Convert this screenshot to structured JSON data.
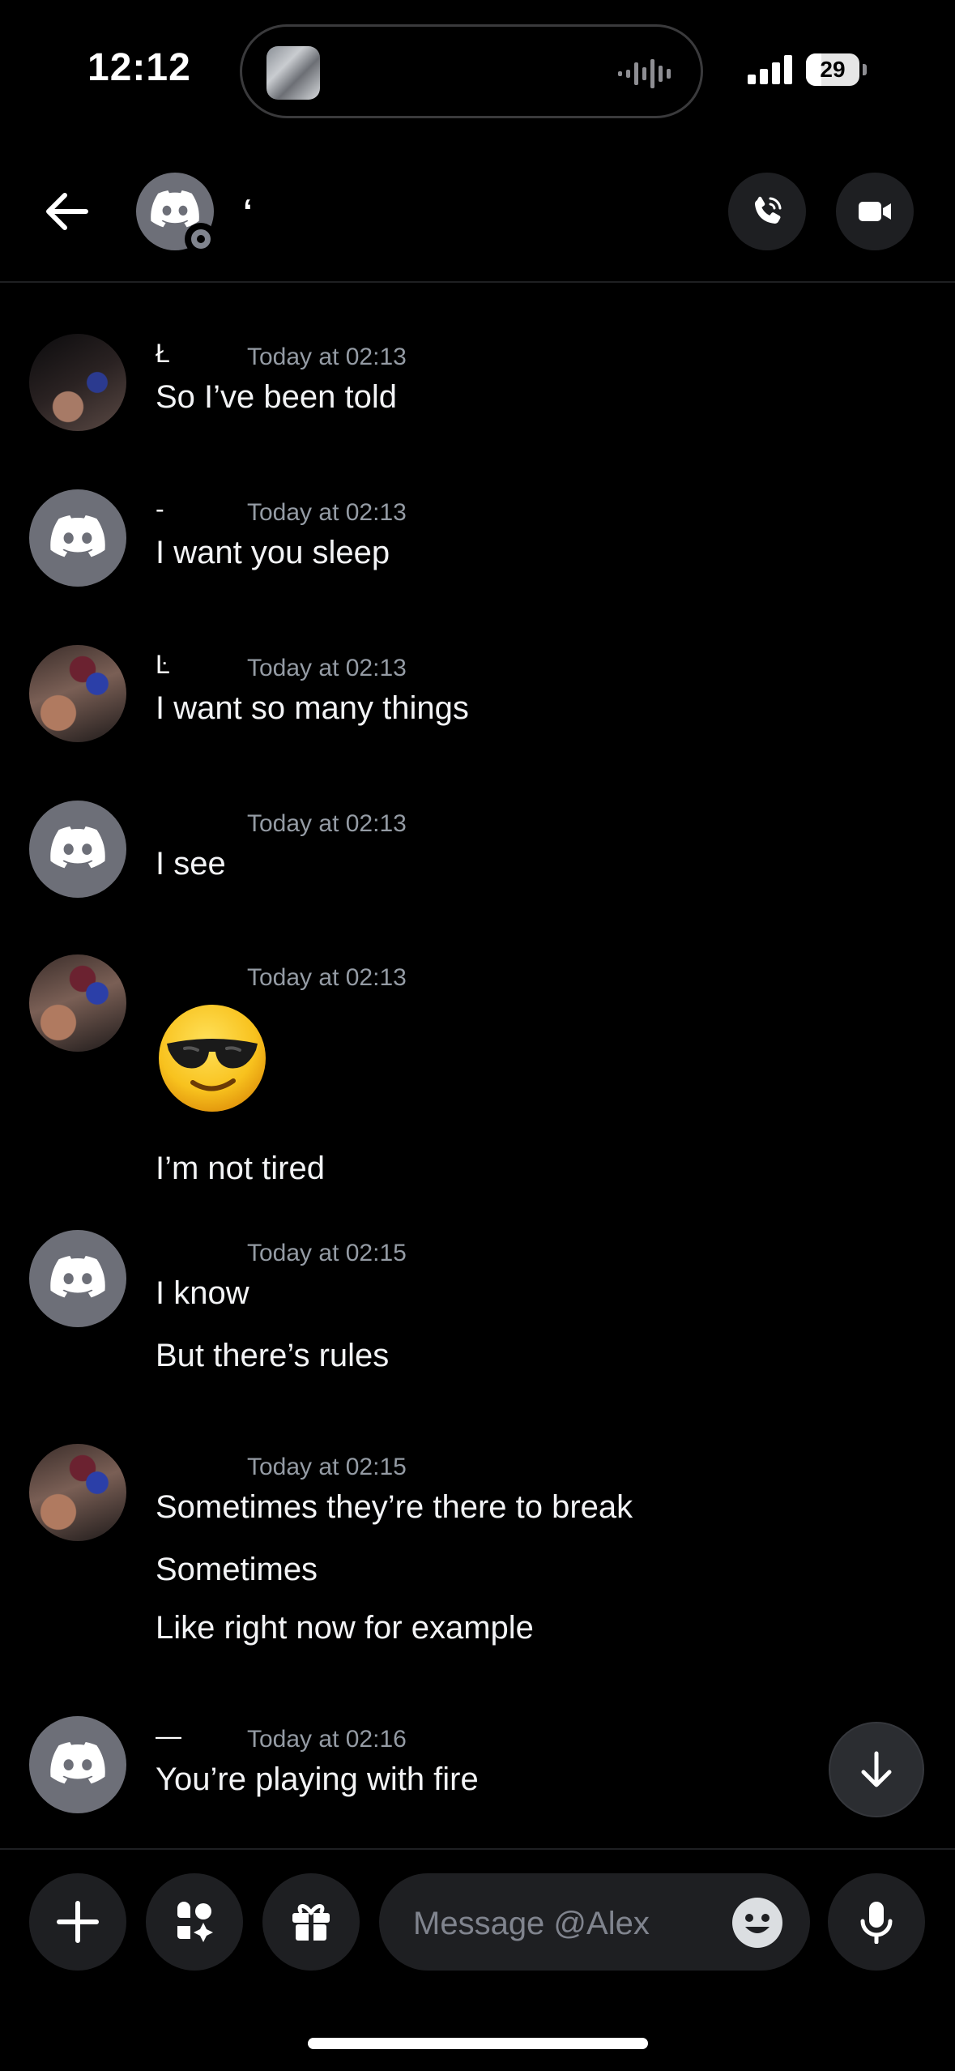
{
  "status_bar": {
    "time": "12:12",
    "battery": "29",
    "battery_level_percent": 29
  },
  "header": {
    "name": "‘",
    "back_icon": "arrow-left-icon",
    "call_icon": "phone-icon",
    "video_icon": "video-camera-icon"
  },
  "messages": [
    {
      "name": "Ł",
      "time": "Today at 02:13",
      "lines": [
        "So I’ve been told"
      ]
    },
    {
      "name": "-",
      "time": "Today at 02:13",
      "lines": [
        "I want you sleep"
      ]
    },
    {
      "name": "Ŀ",
      "time": "Today at 02:13",
      "lines": [
        "I want so many things"
      ]
    },
    {
      "name": "",
      "time": "Today at 02:13",
      "lines": [
        "I see"
      ]
    },
    {
      "name": "",
      "time": "Today at 02:13",
      "emoji": "smiling-face-with-sunglasses",
      "lines": [
        "I’m not tired"
      ]
    },
    {
      "name": "",
      "time": "Today at 02:15",
      "lines": [
        "I know",
        "But there’s rules"
      ]
    },
    {
      "name": "",
      "time": "Today at 02:15",
      "lines": [
        "Sometimes they’re there to break",
        "Sometimes",
        "Like right now for example"
      ]
    },
    {
      "name": "—",
      "time": "Today at 02:16",
      "lines": [
        "You’re playing with fire"
      ]
    }
  ],
  "composer": {
    "placeholder": "Message @Alex",
    "plus_icon": "plus-icon",
    "apps_icon": "apps-icon",
    "gift_icon": "gift-icon",
    "emoji_icon": "emoji-icon",
    "mic_icon": "microphone-icon"
  },
  "colors": {
    "background": "#000000",
    "surface": "#1e1f22",
    "avatar_gray": "#6d6f78",
    "muted_text": "#949ba4",
    "placeholder_text": "#80848e"
  }
}
